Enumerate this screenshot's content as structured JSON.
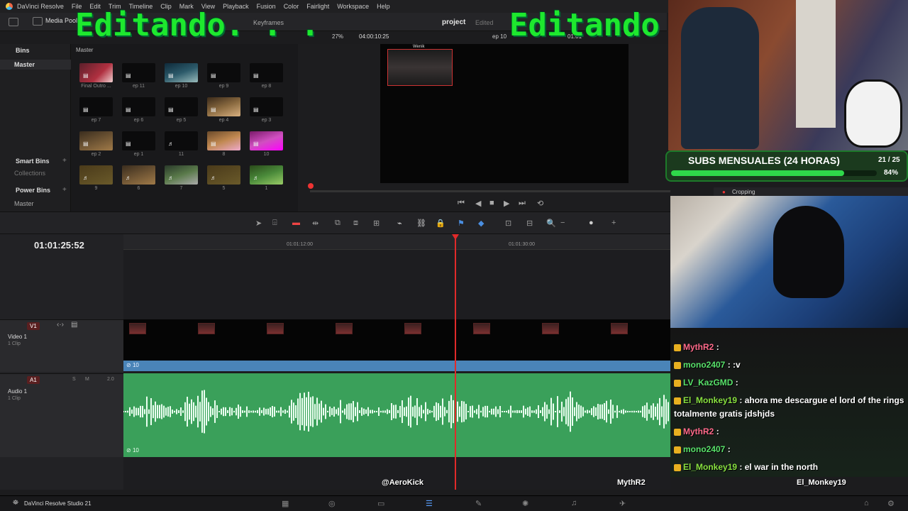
{
  "menubar": {
    "app": "DaVinci Resolve",
    "items": [
      "File",
      "Edit",
      "Trim",
      "Timeline",
      "Clip",
      "Mark",
      "View",
      "Playback",
      "Fusion",
      "Color",
      "Fairlight",
      "Workspace",
      "Help"
    ]
  },
  "toolbar": {
    "media_pool": "Media Pool",
    "keyframes": "Keyframes"
  },
  "project": {
    "title": "project",
    "status": "Edited"
  },
  "viewer": {
    "zoom": "27%",
    "timecode": "04:00:10:25",
    "clip_name": "ep 10",
    "timecode2": "01:01",
    "pip_label": "Wenik"
  },
  "bins": {
    "header": "Bins",
    "master": "Master",
    "smart_bins": "Smart Bins",
    "collections": "Collections",
    "power_bins": "Power Bins",
    "power_master": "Master"
  },
  "pool": {
    "header": "Master",
    "clips": [
      {
        "label": "Final Outro ...",
        "icon": "▤"
      },
      {
        "label": "ep 11",
        "icon": "▤"
      },
      {
        "label": "ep 10",
        "icon": "▤"
      },
      {
        "label": "ep 9",
        "icon": "▤"
      },
      {
        "label": "ep 8",
        "icon": "▤"
      },
      {
        "label": "ep 7",
        "icon": "▤"
      },
      {
        "label": "ep 6",
        "icon": "▤"
      },
      {
        "label": "ep 5",
        "icon": "▤"
      },
      {
        "label": "ep 4",
        "icon": "▤"
      },
      {
        "label": "ep 3",
        "icon": "▤"
      },
      {
        "label": "ep 2",
        "icon": "▤"
      },
      {
        "label": "ep 1",
        "icon": "▤"
      },
      {
        "label": "11",
        "icon": "♬"
      },
      {
        "label": "8",
        "icon": "▤"
      },
      {
        "label": "10",
        "icon": "▤"
      },
      {
        "label": "9",
        "icon": "♬"
      },
      {
        "label": "6",
        "icon": "♬"
      },
      {
        "label": "7",
        "icon": "♬"
      },
      {
        "label": "5",
        "icon": "♬"
      },
      {
        "label": "1",
        "icon": "♬"
      }
    ]
  },
  "timeline": {
    "timecode": "01:01:25:52",
    "ruler": [
      "01:01:12:00",
      "01:01:30:00"
    ],
    "v1": {
      "badge": "V1",
      "name": "Video 1",
      "count": "1 Clip",
      "clip_label": "10"
    },
    "a1": {
      "badge": "A1",
      "name": "Audio 1",
      "count": "1 Clip",
      "level": "2.0",
      "clip_label": "10",
      "s": "S",
      "m": "M"
    }
  },
  "bottombar": {
    "app": "DaVinci Resolve Studio 21"
  },
  "overlay": {
    "big_left": "Editando. . .",
    "big_right": "Editando",
    "subs": {
      "title": "SUBS MENSUALES (24 HORAS)",
      "count": "21 / 25",
      "percent": "84%",
      "progress": 0.84
    },
    "crop_label": "Cropping",
    "chat": [
      {
        "user": "MythR2",
        "text": ":",
        "color": "#ff6a8a"
      },
      {
        "user": "mono2407",
        "text": ": :v",
        "color": "#58e26a"
      },
      {
        "user": "LV_KazGMD",
        "text": ":",
        "color": "#58e26a"
      },
      {
        "user": "El_Monkey19",
        "text": ": ahora me descargue el lord of the rings totalmente gratis jdshjds",
        "color": "#88e040"
      },
      {
        "user": "MythR2",
        "text": ":",
        "color": "#ff6a8a"
      },
      {
        "user": "mono2407",
        "text": ":",
        "color": "#58e26a"
      },
      {
        "user": "El_Monkey19",
        "text": ": el war in the north",
        "color": "#88e040"
      }
    ],
    "names": [
      "@AeroKick",
      "MythR2",
      "El_Monkey19"
    ]
  }
}
